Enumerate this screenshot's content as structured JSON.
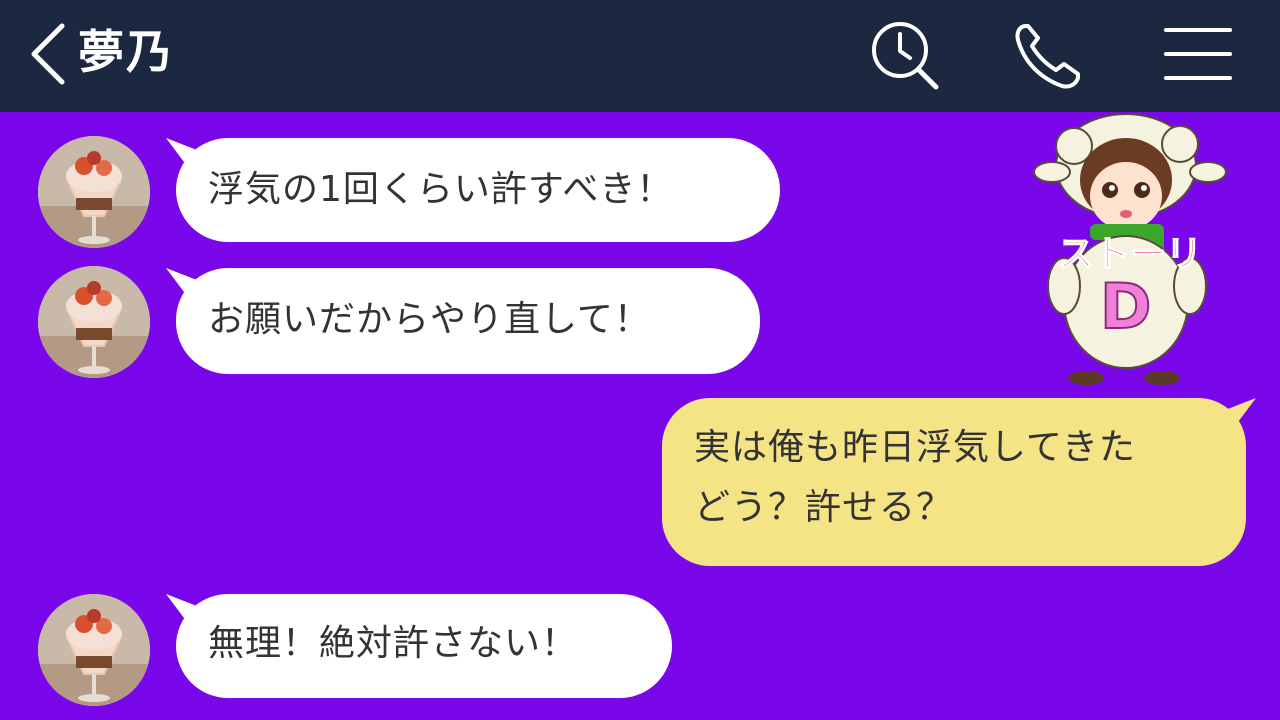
{
  "header": {
    "title": "夢乃",
    "back_icon": "chevron-left-icon",
    "search_icon": "search-clock-icon",
    "phone_icon": "phone-icon",
    "menu_icon": "hamburger-menu-icon"
  },
  "colors": {
    "header_bg": "#1c2740",
    "chat_bg": "#7a07ea",
    "received_bubble": "#ffffff",
    "sent_bubble": "#f4e486"
  },
  "sticker": {
    "overlay_text": "ストーリ",
    "letter": "D"
  },
  "messages": [
    {
      "side": "left",
      "text": "浮気の1回くらい許すべき！"
    },
    {
      "side": "left",
      "text": "お願いだからやり直して！"
    },
    {
      "side": "right",
      "lines": [
        "実は俺も昨日浮気してきた",
        "どう？許せる？"
      ]
    },
    {
      "side": "left",
      "text": "無理！絶対許さない！"
    }
  ]
}
